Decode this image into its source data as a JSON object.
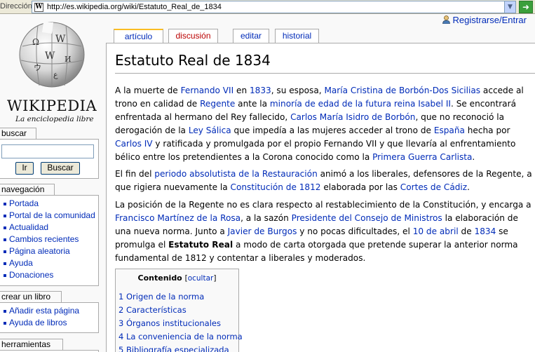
{
  "browser": {
    "address_label": "Dirección",
    "url": "http://es.wikipedia.org/wiki/Estatuto_Real_de_1834",
    "go_icon": "arrow-right-icon"
  },
  "logo": {
    "wordmark": "WIKIPEDIA",
    "tagline": "La enciclopedia libre"
  },
  "personal": {
    "login": "Registrarse/Entrar"
  },
  "tabs": [
    {
      "label": "artículo"
    },
    {
      "label": "discusión"
    },
    {
      "label": "editar"
    },
    {
      "label": "historial"
    }
  ],
  "search": {
    "heading": "buscar",
    "input_value": "",
    "go_label": "Ir",
    "search_label": "Buscar"
  },
  "navigation": {
    "heading": "navegación",
    "items": [
      "Portada",
      "Portal de la comunidad",
      "Actualidad",
      "Cambios recientes",
      "Página aleatoria",
      "Ayuda",
      "Donaciones"
    ]
  },
  "book": {
    "heading": "crear un libro",
    "items": [
      "Añadir esta página",
      "Ayuda de libros"
    ]
  },
  "tools": {
    "heading": "herramientas"
  },
  "article": {
    "title": "Estatuto Real de 1834",
    "p1": {
      "t0": "A la muerte de ",
      "l0": "Fernando VII",
      "t1": " en ",
      "l1": "1833",
      "t2": ", su esposa, ",
      "l2": "María Cristina de Borbón-Dos Sicilias",
      "t3": " accede al trono en calidad de ",
      "l3": "Regente",
      "t4": " ante la ",
      "l4": "minoría de edad de la futura reina Isabel II",
      "t5": ". Se encontrará enfrentada al hermano del Rey fallecido, ",
      "l5": "Carlos María Isidro de Borbón",
      "t6": ", que no reconoció la derogación de la ",
      "l6": "Ley Sálica",
      "t7": " que impedía a las mujeres acceder al trono de ",
      "l7": "España",
      "t8": " hecha por ",
      "l8": "Carlos IV",
      "t9": " y ratificada y promulgada por el propio Fernando VII y que llevaría al enfrentamiento bélico entre los pretendientes a la Corona conocido como la ",
      "l9": "Primera Guerra Carlista",
      "t10": "."
    },
    "p2": {
      "t0": "El fin del ",
      "l0": "periodo absolutista de la Restauración",
      "t1": " animó a los liberales, defensores de la Regente, a que rigiera nuevamente la ",
      "l1": "Constitución de 1812",
      "t2": " elaborada por las ",
      "l2": "Cortes de Cádiz",
      "t3": "."
    },
    "p3": {
      "t0": "La posición de la Regente no es clara respecto al restablecimiento de la Constitución, y encarga a ",
      "l0": "Francisco Martínez de la Rosa",
      "t1": ", a la sazón ",
      "l1": "Presidente del Consejo de Ministros",
      "t2": " la elaboración de una nueva norma. Junto a ",
      "l2": "Javier de Burgos",
      "t3": " y no pocas dificultades, el ",
      "l3": "10 de abril",
      "t4": " de ",
      "l4": "1834",
      "t5": " se promulga el ",
      "b0": "Estatuto Real",
      "t6": " a modo de carta otorgada que pretende superar la anterior norma fundamental de 1812 y contentar a liberales y moderados."
    }
  },
  "toc": {
    "title": "Contenido",
    "hide_open": "[",
    "hide_label": "ocultar",
    "hide_close": "]",
    "items": [
      "1 Origen de la norma",
      "2 Características",
      "3 Órganos institucionales",
      "4 La conveniencia de la norma",
      "5 Bibliografía especializada"
    ]
  }
}
